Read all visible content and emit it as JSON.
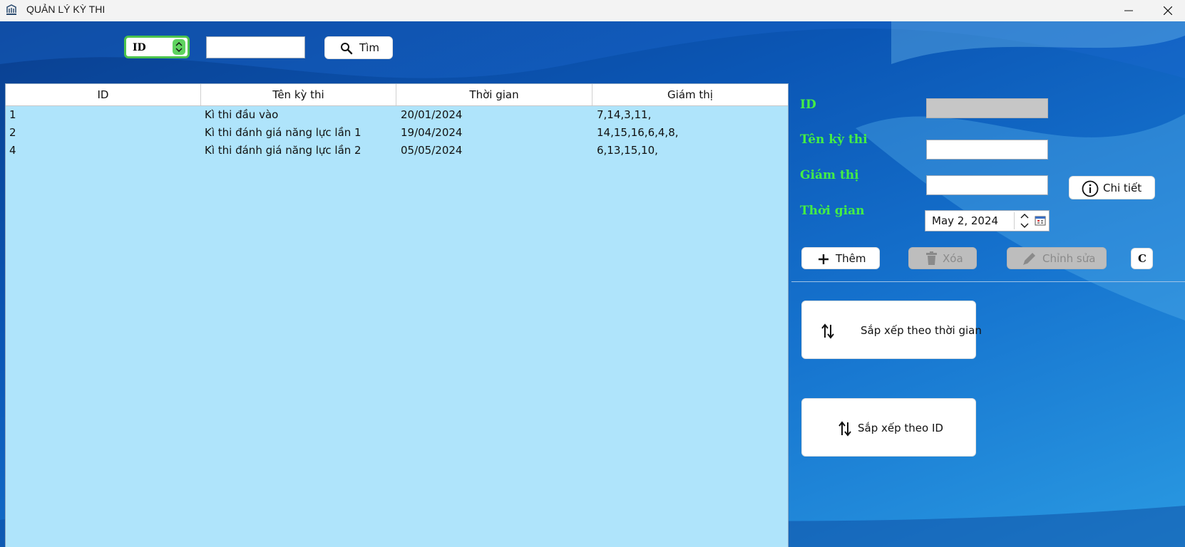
{
  "window": {
    "title": "QUẢN LÝ KỲ THI"
  },
  "search": {
    "field_selected": "ID",
    "query": "",
    "button_label": "Tìm"
  },
  "table": {
    "columns": [
      "ID",
      "Tên kỳ thi",
      "Thời gian",
      "Giám thị"
    ],
    "rows": [
      [
        "1",
        "Kì thi đầu vào",
        "20/01/2024",
        "7,14,3,11,"
      ],
      [
        "2",
        "Kì thi đánh giá năng lực lần 1",
        "19/04/2024",
        "14,15,16,6,4,8,"
      ],
      [
        "4",
        "Kì thi đánh giá năng lực lần 2",
        "05/05/2024",
        "6,13,15,10,"
      ]
    ]
  },
  "form": {
    "id_label": "ID",
    "id_value": "",
    "name_label": "Tên kỳ thi",
    "name_value": "",
    "supervisor_label": "Giám thị",
    "supervisor_value": "",
    "time_label": "Thời gian",
    "date_value": "May 2, 2024",
    "detail_button": "Chi tiết"
  },
  "actions": {
    "add": "Thêm",
    "delete": "Xóa",
    "edit": "Chỉnh sửa",
    "clear": "C"
  },
  "sort": {
    "by_time": "Sắp xếp theo thời gian",
    "by_id": "Sắp xếp theo ID"
  },
  "colors": {
    "label_green": "#44ee44",
    "table_bg": "#afe4fb",
    "bg_dark_blue": "#0a3f8f",
    "combo_border": "#4cc34c"
  },
  "icons": [
    "app-icon",
    "minimize-icon",
    "close-icon",
    "search-icon",
    "info-icon",
    "plus-icon",
    "trash-icon",
    "pencil-icon",
    "sort-icon",
    "calendar-icon"
  ]
}
